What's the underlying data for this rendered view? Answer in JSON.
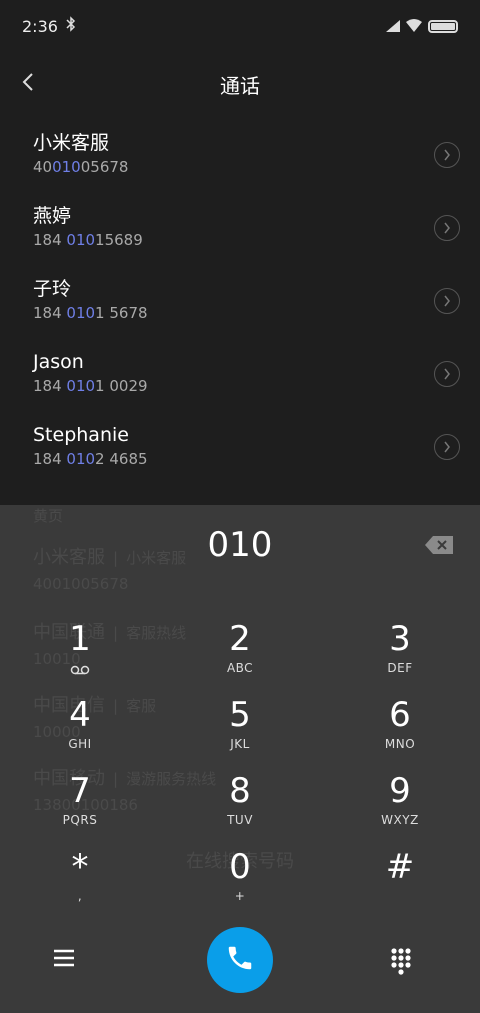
{
  "status": {
    "time": "2:36"
  },
  "header": {
    "title": "通话"
  },
  "contacts": [
    {
      "name": "小米客服",
      "num_pre": "40",
      "num_hl": "010",
      "num_post": "05678"
    },
    {
      "name": "燕婷",
      "num_pre": "184 ",
      "num_hl": "010",
      "num_post": "15689"
    },
    {
      "name": "子玲",
      "num_pre": "184 ",
      "num_hl": "010",
      "num_post": "1 5678"
    },
    {
      "name": "Jason",
      "num_pre": "184 ",
      "num_hl": "010",
      "num_post": "1 0029"
    },
    {
      "name": "Stephanie",
      "num_pre": "184 ",
      "num_hl": "010",
      "num_post": "2 4685"
    }
  ],
  "yellow_pages": {
    "section_label": "黄页",
    "entries": [
      {
        "name": "小米客服",
        "tag": "小米客服",
        "number": "4001005678"
      },
      {
        "name": "中国联通",
        "tag": "客服热线",
        "number": "10010"
      },
      {
        "name": "中国电信",
        "tag": "客服",
        "number": "10000"
      },
      {
        "name": "中国移动",
        "tag": "漫游服务热线",
        "number": "13800100186"
      }
    ],
    "online_search": "在线搜索号码"
  },
  "dialpad": {
    "input": "010",
    "keys": [
      {
        "digit": "1",
        "letters": ""
      },
      {
        "digit": "2",
        "letters": "ABC"
      },
      {
        "digit": "3",
        "letters": "DEF"
      },
      {
        "digit": "4",
        "letters": "GHI"
      },
      {
        "digit": "5",
        "letters": "JKL"
      },
      {
        "digit": "6",
        "letters": "MNO"
      },
      {
        "digit": "7",
        "letters": "PQRS"
      },
      {
        "digit": "8",
        "letters": "TUV"
      },
      {
        "digit": "9",
        "letters": "WXYZ"
      },
      {
        "digit": "*",
        "letters": ","
      },
      {
        "digit": "0",
        "letters": "+"
      },
      {
        "digit": "#",
        "letters": ""
      }
    ]
  },
  "colors": {
    "highlight": "#6f7fe6",
    "call_button": "#0a9ee9",
    "dialpad_bg": "#3a3a3a",
    "list_bg": "#1e1e1e"
  },
  "icons": [
    "bluetooth-icon",
    "signal-icon",
    "wifi-icon",
    "battery-icon",
    "back-icon",
    "chevron-right-icon",
    "voicemail-icon",
    "backspace-icon",
    "menu-icon",
    "phone-icon",
    "keypad-icon"
  ]
}
